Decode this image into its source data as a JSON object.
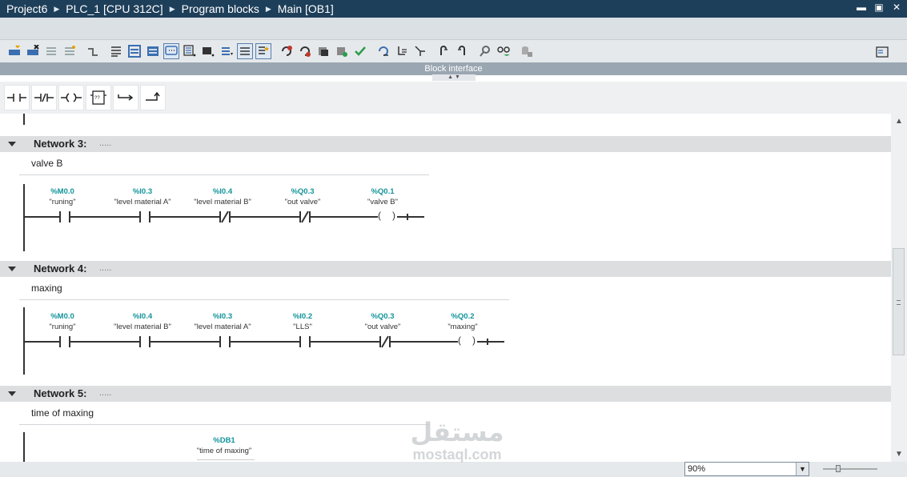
{
  "breadcrumb": [
    "Project6",
    "PLC_1 [CPU 312C]",
    "Program blocks",
    "Main [OB1]"
  ],
  "window_buttons": [
    "▬",
    "▣",
    "✕"
  ],
  "block_interface_label": "Block interface",
  "zoom": {
    "value": "90%"
  },
  "watermark": {
    "arabic": "مستقل",
    "latin": "mostaql.com"
  },
  "ladder_tools": [
    "normally-open-contact",
    "normally-closed-contact",
    "output-coil",
    "empty-box",
    "open-branch",
    "close-branch"
  ],
  "networks": [
    {
      "title": "Network 3:",
      "dots": ".....",
      "comment": "valve B",
      "elements": [
        {
          "type": "NO",
          "address": "%M0.0",
          "tag": "\"runing\""
        },
        {
          "type": "NO",
          "address": "%I0.3",
          "tag": "\"level material A\""
        },
        {
          "type": "NC",
          "address": "%I0.4",
          "tag": "\"level material B\""
        },
        {
          "type": "NC",
          "address": "%Q0.3",
          "tag": "\"out valve\""
        },
        {
          "type": "COIL",
          "address": "%Q0.1",
          "tag": "\"valve B\""
        }
      ]
    },
    {
      "title": "Network 4:",
      "dots": ".....",
      "comment": "maxing",
      "elements": [
        {
          "type": "NO",
          "address": "%M0.0",
          "tag": "\"runing\""
        },
        {
          "type": "NO",
          "address": "%I0.4",
          "tag": "\"level material B\""
        },
        {
          "type": "NO",
          "address": "%I0.3",
          "tag": "\"level material A\""
        },
        {
          "type": "NO",
          "address": "%I0.2",
          "tag": "\"LLS\""
        },
        {
          "type": "NC",
          "address": "%Q0.3",
          "tag": "\"out valve\""
        },
        {
          "type": "COIL",
          "address": "%Q0.2",
          "tag": "\"maxing\""
        }
      ]
    },
    {
      "title": "Network 5:",
      "dots": ".....",
      "comment": "time of maxing",
      "elements": [
        {
          "type": "BOX",
          "address": "%DB1",
          "tag": "\"time of maxing\""
        }
      ]
    }
  ]
}
